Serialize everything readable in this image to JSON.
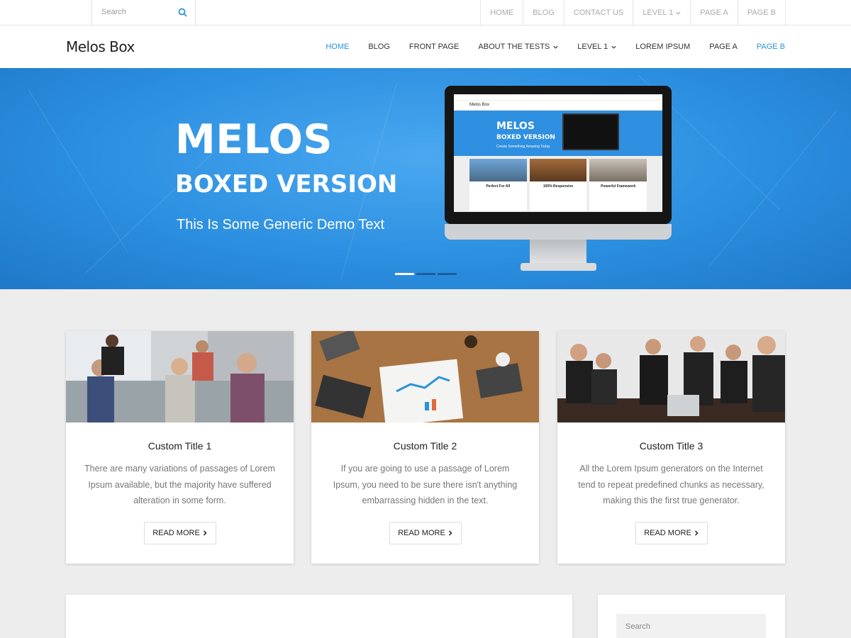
{
  "topbar": {
    "search_placeholder": "Search",
    "nav": [
      {
        "label": "HOME"
      },
      {
        "label": "BLOG"
      },
      {
        "label": "CONTACT US"
      },
      {
        "label": "LEVEL 1"
      },
      {
        "label": "PAGE A"
      },
      {
        "label": "PAGE B"
      }
    ]
  },
  "header": {
    "logo": "Melos Box",
    "nav": [
      {
        "label": "HOME",
        "active": true
      },
      {
        "label": "BLOG"
      },
      {
        "label": "FRONT PAGE"
      },
      {
        "label": "ABOUT THE TESTS"
      },
      {
        "label": "LEVEL 1"
      },
      {
        "label": "LOREM IPSUM"
      },
      {
        "label": "PAGE A"
      },
      {
        "label": "PAGE B",
        "highlight": true
      }
    ]
  },
  "hero": {
    "title": "MELOS",
    "subtitle": "BOXED VERSION",
    "text": "This Is Some Generic Demo Text",
    "slides": 3,
    "active_slide": 1,
    "mockup": {
      "logo": "Melos Box",
      "title": "MELOS",
      "subtitle": "BOXED VERSION",
      "text": "Create Something Amazing Today",
      "cards": [
        "Perfect For All",
        "100% Responsive",
        "Powerful Framework"
      ]
    }
  },
  "cards": [
    {
      "title": "Custom Title 1",
      "text": "There are many variations of passages of Lorem Ipsum available, but the majority have suffered alteration in some form.",
      "button": "READ MORE"
    },
    {
      "title": "Custom Title 2",
      "text": "If you are going to use a passage of Lorem Ipsum, you need to be sure there isn't anything embarrassing hidden in the text.",
      "button": "READ MORE"
    },
    {
      "title": "Custom Title 3",
      "text": "All the Lorem Ipsum generators on the Internet tend to repeat predefined chunks as necessary, making this the first true generator.",
      "button": "READ MORE"
    }
  ],
  "sidebar": {
    "search_placeholder": "Search"
  },
  "colors": {
    "accent": "#2b93d9",
    "hero_bg": "#2c8fe0"
  }
}
